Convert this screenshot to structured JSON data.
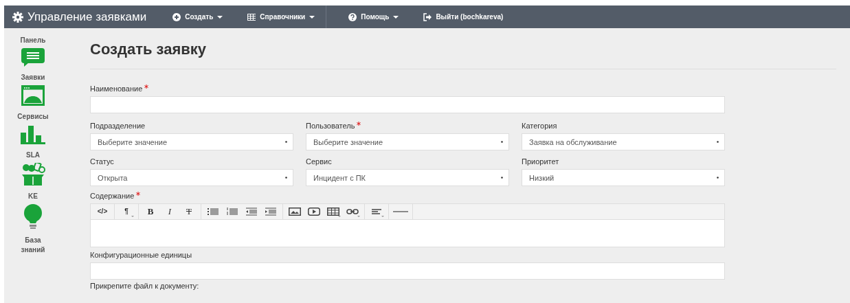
{
  "navbar": {
    "brand": "Управление заявками",
    "menus": [
      {
        "kind": "create",
        "label": "Создать",
        "caret": true
      },
      {
        "kind": "directory",
        "label": "Справочники",
        "caret": true
      },
      {
        "kind": "help",
        "label": "Помощь",
        "caret": true
      },
      {
        "kind": "logout",
        "label": "Выйти (bochkareva)",
        "caret": false
      }
    ]
  },
  "sidebar": {
    "items": [
      {
        "kind": "chat",
        "label": "Панель"
      },
      {
        "kind": "window",
        "label": "Заявки"
      },
      {
        "kind": "chart",
        "label": "Сервисы"
      },
      {
        "kind": "people",
        "label": "SLA"
      },
      {
        "kind": "bulb",
        "label": "KE"
      }
    ],
    "footer": "База знаний"
  },
  "page_title": "Создать заявку",
  "form": {
    "name": {
      "label": "Наименование",
      "required": true
    },
    "selects": [
      {
        "label": "Подразделение",
        "required": false,
        "value": "Выберите значение"
      },
      {
        "label": "Пользователь",
        "required": true,
        "value": "Выберите значение"
      },
      {
        "label": "Категория",
        "required": false,
        "value": "Заявка на обслуживание"
      },
      {
        "label": "Статус",
        "required": false,
        "value": "Открыта"
      },
      {
        "label": "Сервис",
        "required": false,
        "value": "Инцидент с ПК"
      },
      {
        "label": "Приоритет",
        "required": false,
        "value": "Низкий"
      }
    ],
    "content": {
      "label": "Содержание",
      "required": true,
      "toolbar": [
        [
          {
            "kind": "text",
            "label": "</>"
          }
        ],
        [
          {
            "kind": "text",
            "label": "¶",
            "caret": true
          }
        ],
        [
          {
            "kind": "bold",
            "label": "B"
          },
          {
            "kind": "italic",
            "label": "I"
          },
          {
            "kind": "strike",
            "label": "T"
          }
        ],
        [
          {
            "kind": "ul"
          },
          {
            "kind": "ol"
          },
          {
            "kind": "outdent"
          },
          {
            "kind": "indent"
          }
        ],
        [
          {
            "kind": "image"
          },
          {
            "kind": "video"
          },
          {
            "kind": "table",
            "caret": true
          },
          {
            "kind": "link",
            "caret": true
          }
        ],
        [
          {
            "kind": "align",
            "caret": true
          }
        ],
        [
          {
            "kind": "rule"
          }
        ]
      ]
    },
    "config": {
      "label": "Конфигурационные единицы",
      "required": false
    },
    "attach": {
      "label": "Прикрепите файл к документу:"
    }
  }
}
